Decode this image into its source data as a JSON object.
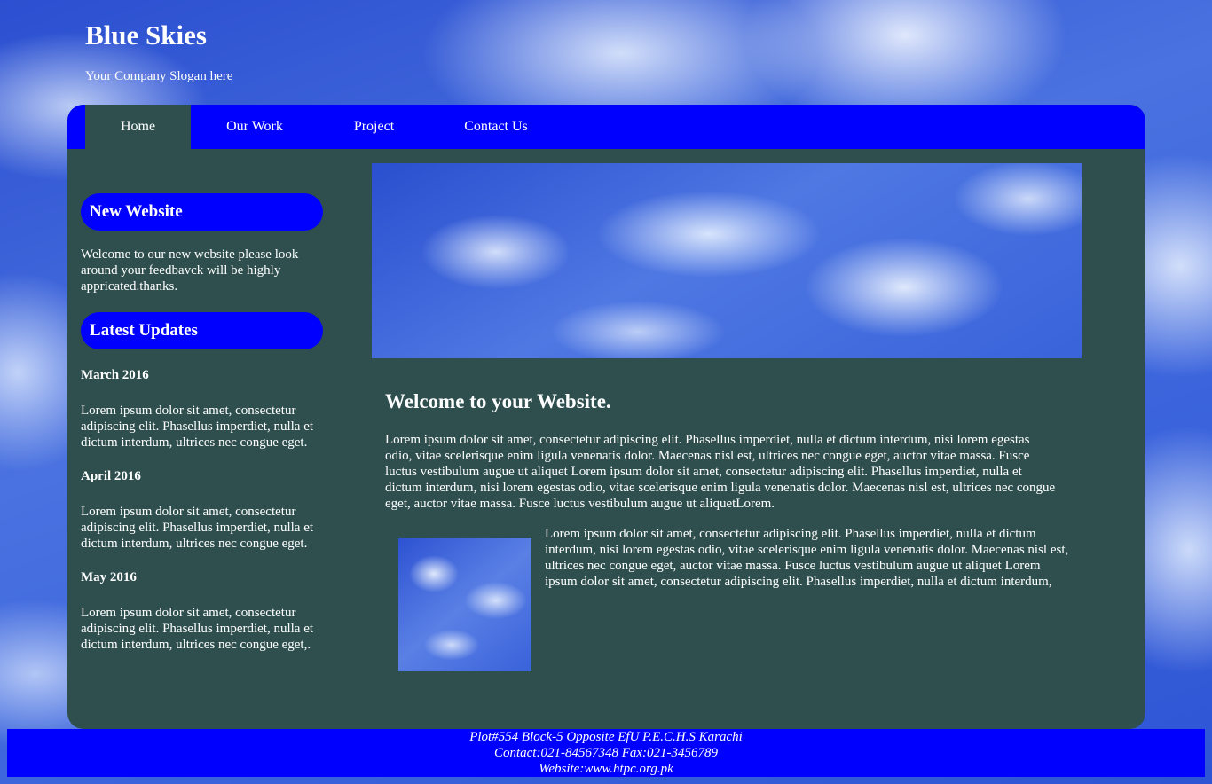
{
  "header": {
    "title": "Blue Skies",
    "slogan": "Your Company Slogan here"
  },
  "nav": {
    "items": [
      "Home",
      "Our Work",
      "Project",
      "Contact Us"
    ],
    "active": "Home"
  },
  "sidebar": {
    "new_website": {
      "heading": "New Website",
      "text": "Welcome to our new website please look around your feedbavck will be highly appricated.thanks."
    },
    "latest_updates": {
      "heading": "Latest Updates",
      "entries": [
        {
          "date": "March 2016",
          "text": "Lorem ipsum dolor sit amet, consectetur adipiscing elit. Phasellus imperdiet, nulla et dictum interdum, ultrices nec congue eget."
        },
        {
          "date": "April 2016",
          "text": "Lorem ipsum dolor sit amet, consectetur adipiscing elit. Phasellus imperdiet, nulla et dictum interdum, ultrices nec congue eget."
        },
        {
          "date": "May 2016",
          "text": "Lorem ipsum dolor sit amet, consectetur adipiscing elit. Phasellus imperdiet, nulla et dictum interdum, ultrices nec congue eget,."
        }
      ]
    }
  },
  "main": {
    "heading": "Welcome to your Website.",
    "intro": "Lorem ipsum dolor sit amet, consectetur adipiscing elit. Phasellus imperdiet, nulla et dictum interdum, nisi lorem egestas odio, vitae scelerisque enim ligula venenatis dolor. Maecenas nisl est, ultrices nec congue eget, auctor vitae massa. Fusce luctus vestibulum augue ut aliquet Lorem ipsum dolor sit amet, consectetur adipiscing elit. Phasellus imperdiet, nulla et dictum interdum, nisi lorem egestas odio, vitae scelerisque enim ligula venenatis dolor. Maecenas nisl est, ultrices nec congue eget, auctor vitae massa. Fusce luctus vestibulum augue ut aliquetLorem.",
    "side_text": "Lorem ipsum dolor sit amet, consectetur adipiscing elit. Phasellus imperdiet, nulla et dictum interdum, nisi lorem egestas odio, vitae scelerisque enim ligula venenatis dolor. Maecenas nisl est, ultrices nec congue eget, auctor vitae massa. Fusce luctus vestibulum augue ut aliquet Lorem ipsum dolor sit amet, consectetur adipiscing elit. Phasellus imperdiet, nulla et dictum interdum,"
  },
  "footer": {
    "address": "Plot#554 Block-5 Opposite EfU P.E.C.H.S Karachi",
    "contact": "Contact:021-84567348 Fax:021-3456789",
    "website": "Website:www.htpc.org.pk"
  },
  "colors": {
    "nav_bg": "#0000ff",
    "panel_bg": "#2f4f4f",
    "text": "#ffffff"
  }
}
